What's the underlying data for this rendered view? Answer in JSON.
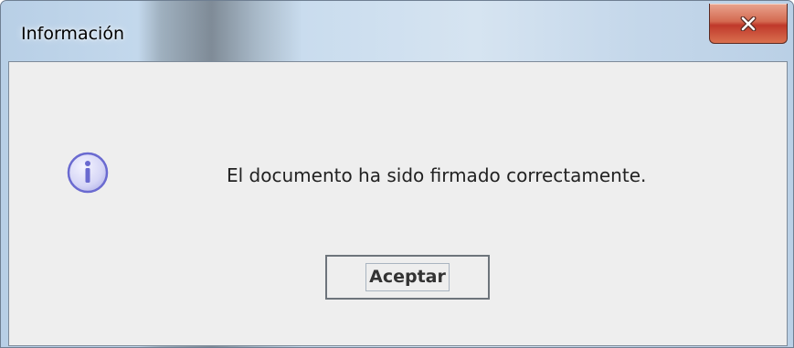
{
  "window": {
    "title": "Información",
    "close_icon": "close-icon"
  },
  "dialog": {
    "icon": "info-icon",
    "message": "El documento ha sido firmado correctamente.",
    "accept_label": "Aceptar"
  },
  "colors": {
    "close_button": "#c9503c",
    "content_bg": "#eeeeee",
    "info_icon_fill": "#dcdcf8",
    "info_icon_stroke": "#6a6ad0"
  }
}
